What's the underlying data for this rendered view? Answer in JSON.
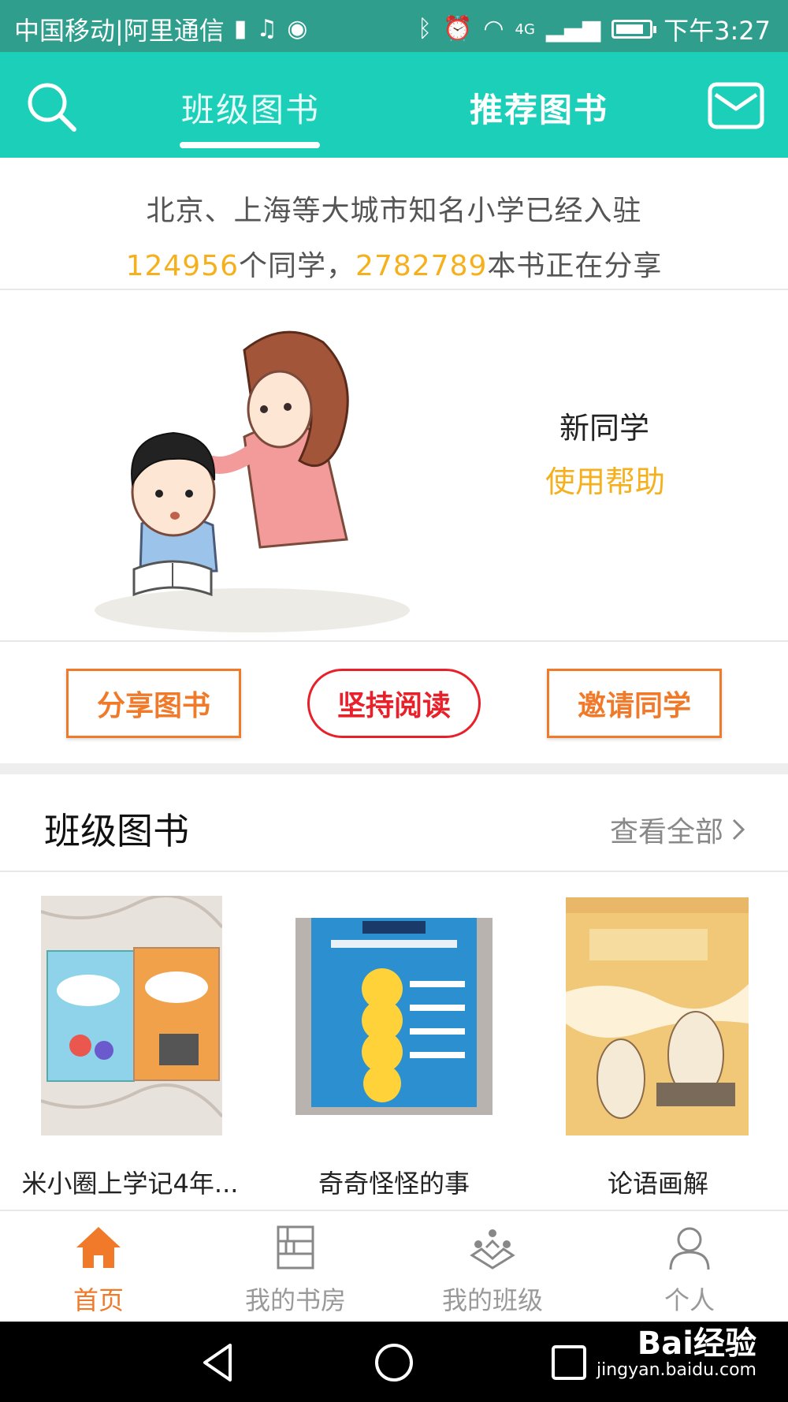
{
  "status_bar": {
    "carrier": "中国移动|阿里通信",
    "time": "下午3:27",
    "network": "4G"
  },
  "top_nav": {
    "tabs": [
      {
        "label": "班级图书",
        "active": true
      },
      {
        "label": "推荐图书",
        "active": false
      }
    ]
  },
  "info": {
    "line1": "北京、上海等大城市知名小学已经入驻",
    "students_count": "124956",
    "students_suffix": "个同学，",
    "books_count": "2782789",
    "books_suffix": "本书正在分享"
  },
  "hero": {
    "newbie_label": "新同学",
    "help_link": "使用帮助"
  },
  "actions": {
    "share": "分享图书",
    "keep_reading": "坚持阅读",
    "invite": "邀请同学"
  },
  "section": {
    "title": "班级图书",
    "view_all": "查看全部"
  },
  "books": [
    {
      "title": "米小圈上学记4年..."
    },
    {
      "title": "奇奇怪怪的事"
    },
    {
      "title": "论语画解"
    }
  ],
  "bottom_nav": [
    {
      "label": "首页",
      "icon": "home-icon",
      "active": true
    },
    {
      "label": "我的书房",
      "icon": "bookshelf-icon",
      "active": false
    },
    {
      "label": "我的班级",
      "icon": "class-icon",
      "active": false
    },
    {
      "label": "个人",
      "icon": "person-icon",
      "active": false
    }
  ],
  "watermark": {
    "brand": "Bai经验",
    "url": "jingyan.baidu.com"
  },
  "colors": {
    "status_bar": "#2f9e8c",
    "nav_teal": "#1ccfb9",
    "highlight_yellow": "#f5b01b",
    "orange": "#f07a2a",
    "red": "#e8202a"
  }
}
